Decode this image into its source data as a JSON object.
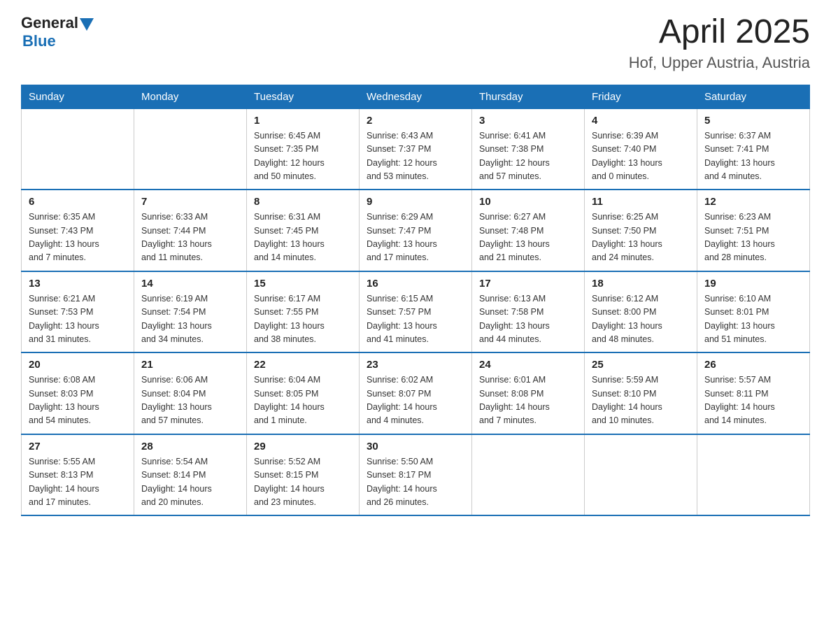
{
  "header": {
    "logo_general": "General",
    "logo_blue": "Blue",
    "title": "April 2025",
    "subtitle": "Hof, Upper Austria, Austria"
  },
  "weekdays": [
    "Sunday",
    "Monday",
    "Tuesday",
    "Wednesday",
    "Thursday",
    "Friday",
    "Saturday"
  ],
  "weeks": [
    [
      {
        "day": "",
        "sunrise": "",
        "sunset": "",
        "daylight": ""
      },
      {
        "day": "",
        "sunrise": "",
        "sunset": "",
        "daylight": ""
      },
      {
        "day": "1",
        "sunrise": "Sunrise: 6:45 AM",
        "sunset": "Sunset: 7:35 PM",
        "daylight": "Daylight: 12 hours and 50 minutes."
      },
      {
        "day": "2",
        "sunrise": "Sunrise: 6:43 AM",
        "sunset": "Sunset: 7:37 PM",
        "daylight": "Daylight: 12 hours and 53 minutes."
      },
      {
        "day": "3",
        "sunrise": "Sunrise: 6:41 AM",
        "sunset": "Sunset: 7:38 PM",
        "daylight": "Daylight: 12 hours and 57 minutes."
      },
      {
        "day": "4",
        "sunrise": "Sunrise: 6:39 AM",
        "sunset": "Sunset: 7:40 PM",
        "daylight": "Daylight: 13 hours and 0 minutes."
      },
      {
        "day": "5",
        "sunrise": "Sunrise: 6:37 AM",
        "sunset": "Sunset: 7:41 PM",
        "daylight": "Daylight: 13 hours and 4 minutes."
      }
    ],
    [
      {
        "day": "6",
        "sunrise": "Sunrise: 6:35 AM",
        "sunset": "Sunset: 7:43 PM",
        "daylight": "Daylight: 13 hours and 7 minutes."
      },
      {
        "day": "7",
        "sunrise": "Sunrise: 6:33 AM",
        "sunset": "Sunset: 7:44 PM",
        "daylight": "Daylight: 13 hours and 11 minutes."
      },
      {
        "day": "8",
        "sunrise": "Sunrise: 6:31 AM",
        "sunset": "Sunset: 7:45 PM",
        "daylight": "Daylight: 13 hours and 14 minutes."
      },
      {
        "day": "9",
        "sunrise": "Sunrise: 6:29 AM",
        "sunset": "Sunset: 7:47 PM",
        "daylight": "Daylight: 13 hours and 17 minutes."
      },
      {
        "day": "10",
        "sunrise": "Sunrise: 6:27 AM",
        "sunset": "Sunset: 7:48 PM",
        "daylight": "Daylight: 13 hours and 21 minutes."
      },
      {
        "day": "11",
        "sunrise": "Sunrise: 6:25 AM",
        "sunset": "Sunset: 7:50 PM",
        "daylight": "Daylight: 13 hours and 24 minutes."
      },
      {
        "day": "12",
        "sunrise": "Sunrise: 6:23 AM",
        "sunset": "Sunset: 7:51 PM",
        "daylight": "Daylight: 13 hours and 28 minutes."
      }
    ],
    [
      {
        "day": "13",
        "sunrise": "Sunrise: 6:21 AM",
        "sunset": "Sunset: 7:53 PM",
        "daylight": "Daylight: 13 hours and 31 minutes."
      },
      {
        "day": "14",
        "sunrise": "Sunrise: 6:19 AM",
        "sunset": "Sunset: 7:54 PM",
        "daylight": "Daylight: 13 hours and 34 minutes."
      },
      {
        "day": "15",
        "sunrise": "Sunrise: 6:17 AM",
        "sunset": "Sunset: 7:55 PM",
        "daylight": "Daylight: 13 hours and 38 minutes."
      },
      {
        "day": "16",
        "sunrise": "Sunrise: 6:15 AM",
        "sunset": "Sunset: 7:57 PM",
        "daylight": "Daylight: 13 hours and 41 minutes."
      },
      {
        "day": "17",
        "sunrise": "Sunrise: 6:13 AM",
        "sunset": "Sunset: 7:58 PM",
        "daylight": "Daylight: 13 hours and 44 minutes."
      },
      {
        "day": "18",
        "sunrise": "Sunrise: 6:12 AM",
        "sunset": "Sunset: 8:00 PM",
        "daylight": "Daylight: 13 hours and 48 minutes."
      },
      {
        "day": "19",
        "sunrise": "Sunrise: 6:10 AM",
        "sunset": "Sunset: 8:01 PM",
        "daylight": "Daylight: 13 hours and 51 minutes."
      }
    ],
    [
      {
        "day": "20",
        "sunrise": "Sunrise: 6:08 AM",
        "sunset": "Sunset: 8:03 PM",
        "daylight": "Daylight: 13 hours and 54 minutes."
      },
      {
        "day": "21",
        "sunrise": "Sunrise: 6:06 AM",
        "sunset": "Sunset: 8:04 PM",
        "daylight": "Daylight: 13 hours and 57 minutes."
      },
      {
        "day": "22",
        "sunrise": "Sunrise: 6:04 AM",
        "sunset": "Sunset: 8:05 PM",
        "daylight": "Daylight: 14 hours and 1 minute."
      },
      {
        "day": "23",
        "sunrise": "Sunrise: 6:02 AM",
        "sunset": "Sunset: 8:07 PM",
        "daylight": "Daylight: 14 hours and 4 minutes."
      },
      {
        "day": "24",
        "sunrise": "Sunrise: 6:01 AM",
        "sunset": "Sunset: 8:08 PM",
        "daylight": "Daylight: 14 hours and 7 minutes."
      },
      {
        "day": "25",
        "sunrise": "Sunrise: 5:59 AM",
        "sunset": "Sunset: 8:10 PM",
        "daylight": "Daylight: 14 hours and 10 minutes."
      },
      {
        "day": "26",
        "sunrise": "Sunrise: 5:57 AM",
        "sunset": "Sunset: 8:11 PM",
        "daylight": "Daylight: 14 hours and 14 minutes."
      }
    ],
    [
      {
        "day": "27",
        "sunrise": "Sunrise: 5:55 AM",
        "sunset": "Sunset: 8:13 PM",
        "daylight": "Daylight: 14 hours and 17 minutes."
      },
      {
        "day": "28",
        "sunrise": "Sunrise: 5:54 AM",
        "sunset": "Sunset: 8:14 PM",
        "daylight": "Daylight: 14 hours and 20 minutes."
      },
      {
        "day": "29",
        "sunrise": "Sunrise: 5:52 AM",
        "sunset": "Sunset: 8:15 PM",
        "daylight": "Daylight: 14 hours and 23 minutes."
      },
      {
        "day": "30",
        "sunrise": "Sunrise: 5:50 AM",
        "sunset": "Sunset: 8:17 PM",
        "daylight": "Daylight: 14 hours and 26 minutes."
      },
      {
        "day": "",
        "sunrise": "",
        "sunset": "",
        "daylight": ""
      },
      {
        "day": "",
        "sunrise": "",
        "sunset": "",
        "daylight": ""
      },
      {
        "day": "",
        "sunrise": "",
        "sunset": "",
        "daylight": ""
      }
    ]
  ]
}
